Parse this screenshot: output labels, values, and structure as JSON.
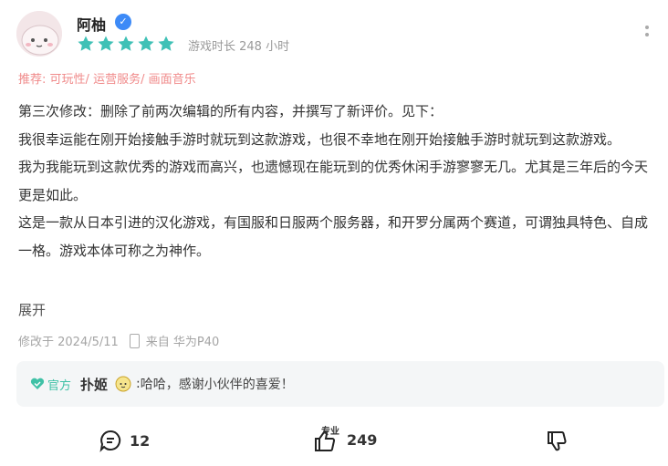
{
  "user": {
    "name": "阿柚",
    "verified_badge": "✓",
    "avatar_icon": "avatar-cartoon"
  },
  "rating": {
    "stars": 5,
    "color": "#3fc1b6"
  },
  "playtime": {
    "label": "游戏时长 248 小时"
  },
  "tags": {
    "label": "推荐:",
    "items": [
      "可玩性",
      "运营服务",
      "画面音乐"
    ]
  },
  "review": {
    "paragraphs": [
      "第三次修改：删除了前两次编辑的所有内容，并撰写了新评价。见下：",
      "我很幸运能在刚开始接触手游时就玩到这款游戏，也很不幸地在刚开始接触手游时就玩到这款游戏。",
      "我为我能玩到这款优秀的游戏而高兴，也遗憾现在能玩到的优秀休闲手游寥寥无几。尤其是三年后的今天更是如此。",
      "这是一款从日本引进的汉化游戏，有国服和日服两个服务器，和开罗分属两个赛道，可谓独具特色、自成一格。游戏本体可称之为神作。"
    ],
    "expand_label": "展开"
  },
  "meta": {
    "modified": "修改于 2024/5/11",
    "device": "来自 华为P40"
  },
  "reply": {
    "official_label": "官方",
    "replier": "扑姬",
    "text": "哈哈，感谢小伙伴的喜爱！"
  },
  "actions": {
    "comments": "12",
    "likes": "249",
    "like_badge": "专业"
  }
}
